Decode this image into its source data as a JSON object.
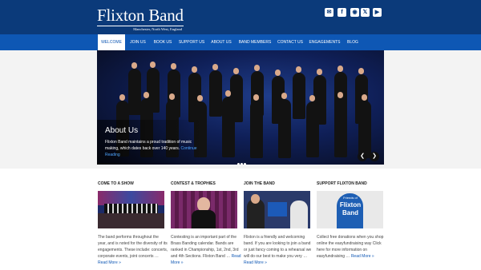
{
  "brand": {
    "title": "Flixton Band",
    "subtitle": "Manchester, North West, England"
  },
  "social": [
    {
      "name": "email-icon",
      "glyph": "✉"
    },
    {
      "name": "facebook-icon",
      "glyph": "f"
    },
    {
      "name": "rss-icon",
      "glyph": "◉"
    },
    {
      "name": "x-icon",
      "glyph": "𝕏"
    },
    {
      "name": "youtube-icon",
      "glyph": "▶"
    }
  ],
  "nav": [
    "WELCOME",
    "JOIN US",
    "BOOK US",
    "SUPPORT US",
    "ABOUT US",
    "BAND MEMBERS",
    "CONTACT US",
    "ENGAGEMENTS",
    "BLOG"
  ],
  "hero": {
    "heading": "About Us",
    "text": "Flixton Band maintains a proud tradition of music making, which dates back over 140 years.",
    "link": "Continue Reading"
  },
  "columns": [
    {
      "title": "COME TO A SHOW",
      "text": "The band performs throughout the year, and is noted for the diversity of its engagements. These include: concerts, corporate events, joint concerts …",
      "more": "Read More »"
    },
    {
      "title": "CONTEST & TROPHIES",
      "text": "Contesting is an important part of the Brass Banding calendar. Bands are ranked in Championship, 1st, 2nd, 3rd and 4th Sections. Flixton Band …",
      "more": "Read More »"
    },
    {
      "title": "JOIN THE BAND",
      "text": "Flixton is a friendly and welcoming band. If you are looking to join a band or just fancy coming to a rehearsal we will do our best to make you very …",
      "more": "Read More »"
    },
    {
      "title": "SUPPORT FLIXTON BAND",
      "text": "Collect free donations when you shop online the easyfundraising way Click here for more information on easyfundraising …",
      "more": "Read More »",
      "image_text": [
        "Friends of",
        "Flixton",
        "Band"
      ]
    }
  ],
  "colors": {
    "header": "#0b3a7a",
    "nav": "#0e57b4",
    "link": "#0e57b4"
  }
}
